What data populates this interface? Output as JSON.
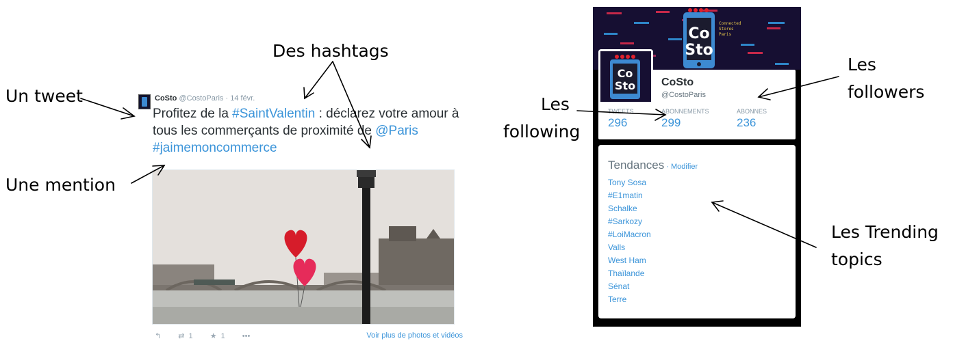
{
  "annotations": {
    "un_tweet": "Un tweet",
    "des_hashtags": "Des hashtags",
    "une_mention": "Une mention",
    "les_following_1": "Les",
    "les_following_2": "following",
    "les_followers_1": "Les",
    "les_followers_2": "followers",
    "les_trending_1": "Les Trending",
    "les_trending_2": "topics"
  },
  "tweet": {
    "author_name": "CoSto",
    "author_handle": "@CostoParis",
    "separator": "·",
    "date": "14 févr.",
    "text_part1": "Profitez de la ",
    "hashtag1": "#SaintValentin",
    "text_part2": " : déclarez votre amour à tous les commerçants de proximité de ",
    "mention": "@Paris",
    "text_space": " ",
    "hashtag2": "#jaimemoncommerce",
    "retweet_count": "1",
    "favorite_count": "1",
    "more_dots": "•••",
    "more_photos_link": "Voir plus de photos et vidéos"
  },
  "banner": {
    "line1": "Connected",
    "line2": "Stores",
    "line3": "Paris"
  },
  "profile": {
    "name": "CoSto",
    "handle": "@CostoParis",
    "stats": [
      {
        "label": "TWEETS",
        "value": "296"
      },
      {
        "label": "ABONNEMENTS",
        "value": "299"
      },
      {
        "label": "ABONNES",
        "value": "236"
      }
    ]
  },
  "trends": {
    "title": "Tendances",
    "separator": " · ",
    "modify": "Modifier",
    "items": [
      "Tony Sosa",
      "#E1matin",
      "Schalke",
      "#Sarkozy",
      "#LoiMacron",
      "Valls",
      "West Ham",
      "Thaïlande",
      "Sénat",
      "Terre"
    ]
  },
  "colors": {
    "link": "#3b94d9",
    "banner_bg": "#160f32",
    "phone_blue": "#3d8ad1",
    "heart_red": "#e0212d"
  }
}
